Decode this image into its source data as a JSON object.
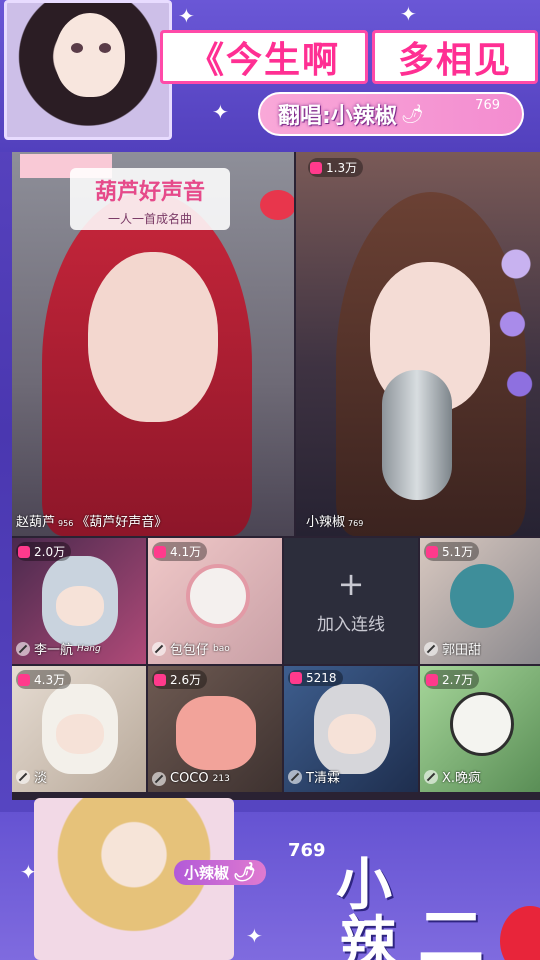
{
  "header": {
    "title_part1": "《今生啊",
    "title_part2": "多相见",
    "singer_label": "翻唱:小辣椒",
    "singer_count": "769"
  },
  "main_left": {
    "show_title": "葫芦好声音",
    "show_subtitle": "一人一首成名曲",
    "name": "赵葫芦",
    "level": "956",
    "tag": "《葫芦好声音》"
  },
  "main_right": {
    "popularity": "1.3万",
    "name": "小辣椒",
    "level": "769"
  },
  "tiles": [
    {
      "popularity": "2.0万",
      "name": "李一航",
      "suffix": "Hang"
    },
    {
      "popularity": "4.1万",
      "name": "包包仔",
      "suffix": "bao"
    },
    {
      "add_label": "加入连线",
      "add_icon": "+"
    },
    {
      "popularity": "5.1万",
      "name": "郭田甜"
    },
    {
      "popularity": "4.3万",
      "name": "淡"
    },
    {
      "popularity": "2.6万",
      "name": "COCO",
      "suffix": "213"
    },
    {
      "popularity": "5218",
      "name": "T清霖"
    },
    {
      "popularity": "2.7万",
      "name": "X.晚疯"
    }
  ],
  "footer": {
    "name": "小辣椒",
    "count": "769",
    "big_char_1": "小",
    "big_char_2": "辣",
    "big_char_3": "二"
  },
  "colors": {
    "accent_pink": "#ff2f93",
    "background_purple": "#5240bd"
  }
}
